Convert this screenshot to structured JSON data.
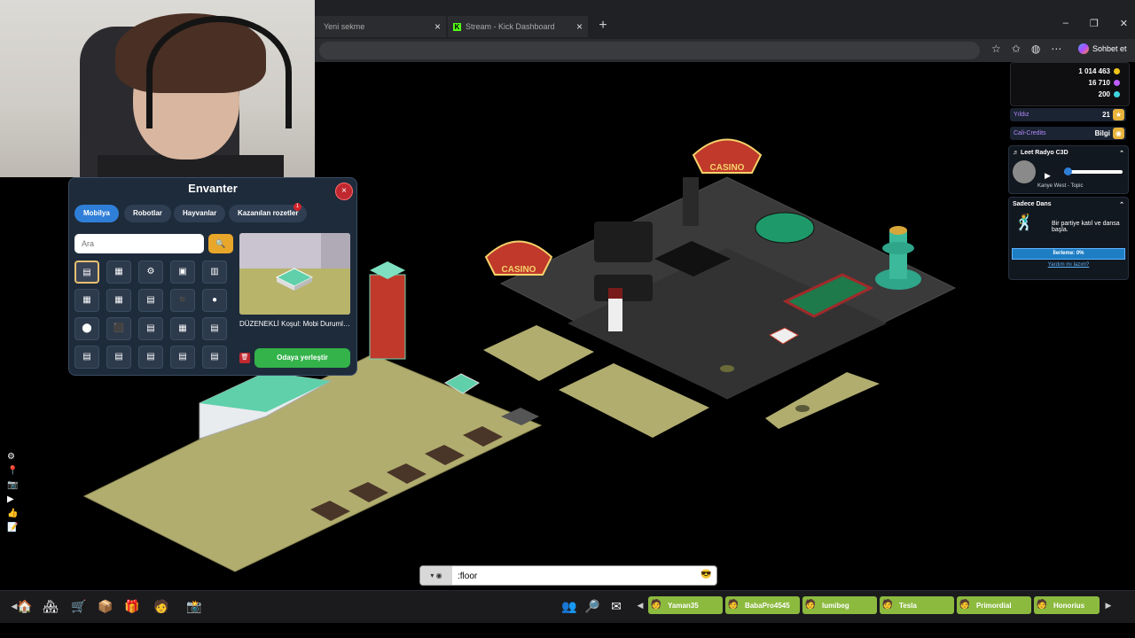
{
  "browser": {
    "tabs": [
      {
        "label": "Yeni sekme"
      },
      {
        "label": "Stream - Kick Dashboard"
      }
    ],
    "new_tab": "+",
    "window_controls": [
      "–",
      "❐",
      "✕"
    ],
    "copilot_label": "Sohbet et"
  },
  "inventory": {
    "title": "Envanter",
    "close": "×",
    "tabs": [
      {
        "label": "Mobilya"
      },
      {
        "label": "Robotlar"
      },
      {
        "label": "Hayvanlar"
      },
      {
        "label": "Kazanılan rozetler"
      }
    ],
    "badge_count": "1",
    "search_placeholder": "Ara",
    "search_icon": "🔍",
    "selected_item_name": "DÜZENEKLİ Koşul: Mobi Durumla...",
    "place_button": "Odaya yerleştir",
    "delete_icon": "🗑",
    "slots": [
      "▤",
      "▦",
      "⚙",
      "▣",
      "▥",
      "▦",
      "▦",
      "▤",
      "◾",
      "●",
      "⬤",
      "⬛",
      "▤",
      "▦",
      "▤",
      "▤",
      "▤",
      "▤",
      "▤",
      "▤"
    ]
  },
  "currency": {
    "credits": "1 014 463",
    "duckets": "16 710",
    "diamonds": "200",
    "credit_color": "#f0c419",
    "ducket_color": "#c05cff",
    "diamond_color": "#3fd4e0"
  },
  "status_bars": [
    {
      "label": "Yıldız",
      "value": "21",
      "icon": "★"
    },
    {
      "label": "Cali-Credits",
      "value": "Bilgi",
      "icon": "◉"
    }
  ],
  "radio": {
    "title": "♬ Leet Radyo C3D",
    "track": "Kanye West - Topic",
    "play_icon": "▶"
  },
  "dance": {
    "title": "Sadece Dans",
    "message": "Bir partiye katıl ve dansa başla.",
    "progress": "İlerleme: 0%",
    "help_link": "Yardım mı lazım?"
  },
  "chat": {
    "value": ":floor",
    "style_icon": "▾ ◉",
    "emoji": "😎"
  },
  "friends": [
    {
      "name": "Yaman35"
    },
    {
      "name": "BabaPro4545"
    },
    {
      "name": "lumibeg"
    },
    {
      "name": "Tesla"
    },
    {
      "name": "Primordial"
    },
    {
      "name": "Honorius"
    }
  ],
  "friend_nav": {
    "prev": "◀",
    "next": "▶"
  },
  "room_signs": [
    "CASINO",
    "CASINO"
  ]
}
